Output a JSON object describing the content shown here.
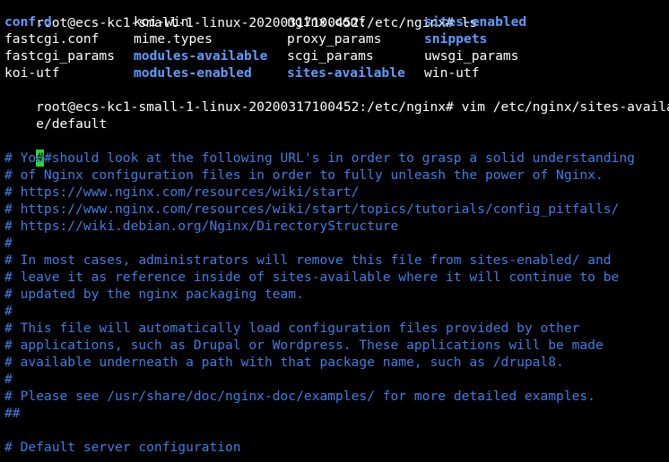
{
  "terminal": {
    "prompt": "root@ecs-kc1-small-1-linux-20200317100452:/etc/nginx#",
    "command_ls": "ls",
    "ls_rows": [
      [
        {
          "name": "conf.d",
          "kind": "dir"
        },
        {
          "name": "koi-win",
          "kind": "file"
        },
        {
          "name": "nginx.conf",
          "kind": "file"
        },
        {
          "name": "sites-enabled",
          "kind": "dir"
        }
      ],
      [
        {
          "name": "fastcgi.conf",
          "kind": "file"
        },
        {
          "name": "mime.types",
          "kind": "file"
        },
        {
          "name": "proxy_params",
          "kind": "file"
        },
        {
          "name": "snippets",
          "kind": "dir"
        }
      ],
      [
        {
          "name": "fastcgi_params",
          "kind": "file"
        },
        {
          "name": "modules-available",
          "kind": "dir"
        },
        {
          "name": "scgi_params",
          "kind": "file"
        },
        {
          "name": "uwsgi_params",
          "kind": "file"
        }
      ],
      [
        {
          "name": "koi-utf",
          "kind": "file"
        },
        {
          "name": "modules-enabled",
          "kind": "dir"
        },
        {
          "name": "sites-available",
          "kind": "dir"
        },
        {
          "name": "win-utf",
          "kind": "file"
        }
      ]
    ],
    "command_vim_line1": "root@ecs-kc1-small-1-linux-20200317100452:/etc/nginx# vim /etc/nginx/sites-availabl",
    "command_vim_line2": "e/default",
    "colors": {
      "background": "#000000",
      "text": "#ffffff",
      "directory": "#5f9dff",
      "comment": "#3f7fe6",
      "cursor": "#2fd62f"
    }
  },
  "editor": {
    "cursor_char": "#",
    "first_line_rest": "#",
    "lines": [
      "# You should look at the following URL's in order to grasp a solid understanding",
      "# of Nginx configuration files in order to fully unleash the power of Nginx.",
      "# https://www.nginx.com/resources/wiki/start/",
      "# https://www.nginx.com/resources/wiki/start/topics/tutorials/config_pitfalls/",
      "# https://wiki.debian.org/Nginx/DirectoryStructure",
      "#",
      "# In most cases, administrators will remove this file from sites-enabled/ and",
      "# leave it as reference inside of sites-available where it will continue to be",
      "# updated by the nginx packaging team.",
      "#",
      "# This file will automatically load configuration files provided by other",
      "# applications, such as Drupal or Wordpress. These applications will be made",
      "# available underneath a path with that package name, such as /drupal8.",
      "#",
      "# Please see /usr/share/doc/nginx-doc/examples/ for more detailed examples.",
      "##",
      "",
      "# Default server configuration"
    ]
  }
}
